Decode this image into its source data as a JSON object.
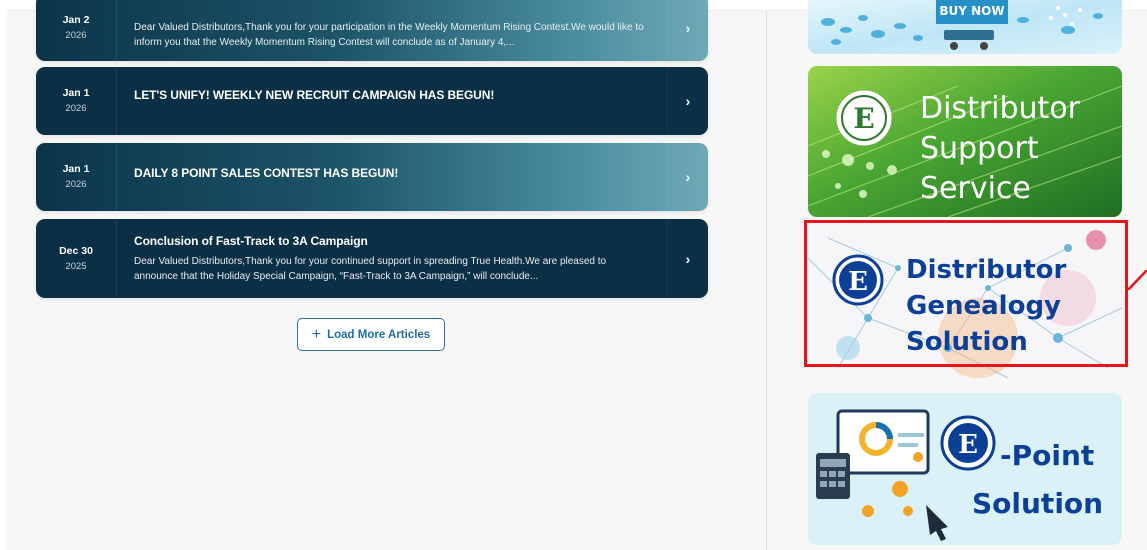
{
  "articles": [
    {
      "date_md": "Jan 2",
      "date_yr": "2026",
      "title": "",
      "excerpt": "Dear Valued Distributors,Thank you for your participation in the Weekly Momentum Rising Contest.We would like to inform you that the Weekly Momentum Rising Contest will conclude as of January 4,..."
    },
    {
      "date_md": "Jan 1",
      "date_yr": "2026",
      "title": "LET'S UNIFY! WEEKLY NEW RECRUIT CAMPAIGN HAS BEGUN!",
      "excerpt": ""
    },
    {
      "date_md": "Jan 1",
      "date_yr": "2026",
      "title": "DAILY 8 POINT SALES CONTEST HAS BEGUN!",
      "excerpt": ""
    },
    {
      "date_md": "Dec 30",
      "date_yr": "2025",
      "title": "Conclusion of Fast-Track to 3A Campaign",
      "excerpt": "Dear Valued Distributors,Thank you for your continued support in spreading True Health.We are pleased to announce that the Holiday Special Campaign, “Fast-Track to 3A Campaign,” will conclude..."
    }
  ],
  "load_more": {
    "icon": "plus-icon",
    "label": "Load More Articles"
  },
  "banners": {
    "buy_now": {
      "text": "BUY NOW"
    },
    "support": {
      "logo_letter": "E",
      "line1": "Distributor",
      "line2": "Support",
      "line3": "Service"
    },
    "genealogy": {
      "logo_letter": "E",
      "line1": "Distributor",
      "line2": "Genealogy",
      "line3": "Solution"
    },
    "epoint": {
      "logo_letter": "E",
      "line1": "-Point",
      "line2": "Solution"
    }
  },
  "colors": {
    "card_dark": "#0b2f45",
    "highlight": "#e8141b",
    "brand_blue": "#0c3f96",
    "link_blue": "#1f6ba6"
  }
}
